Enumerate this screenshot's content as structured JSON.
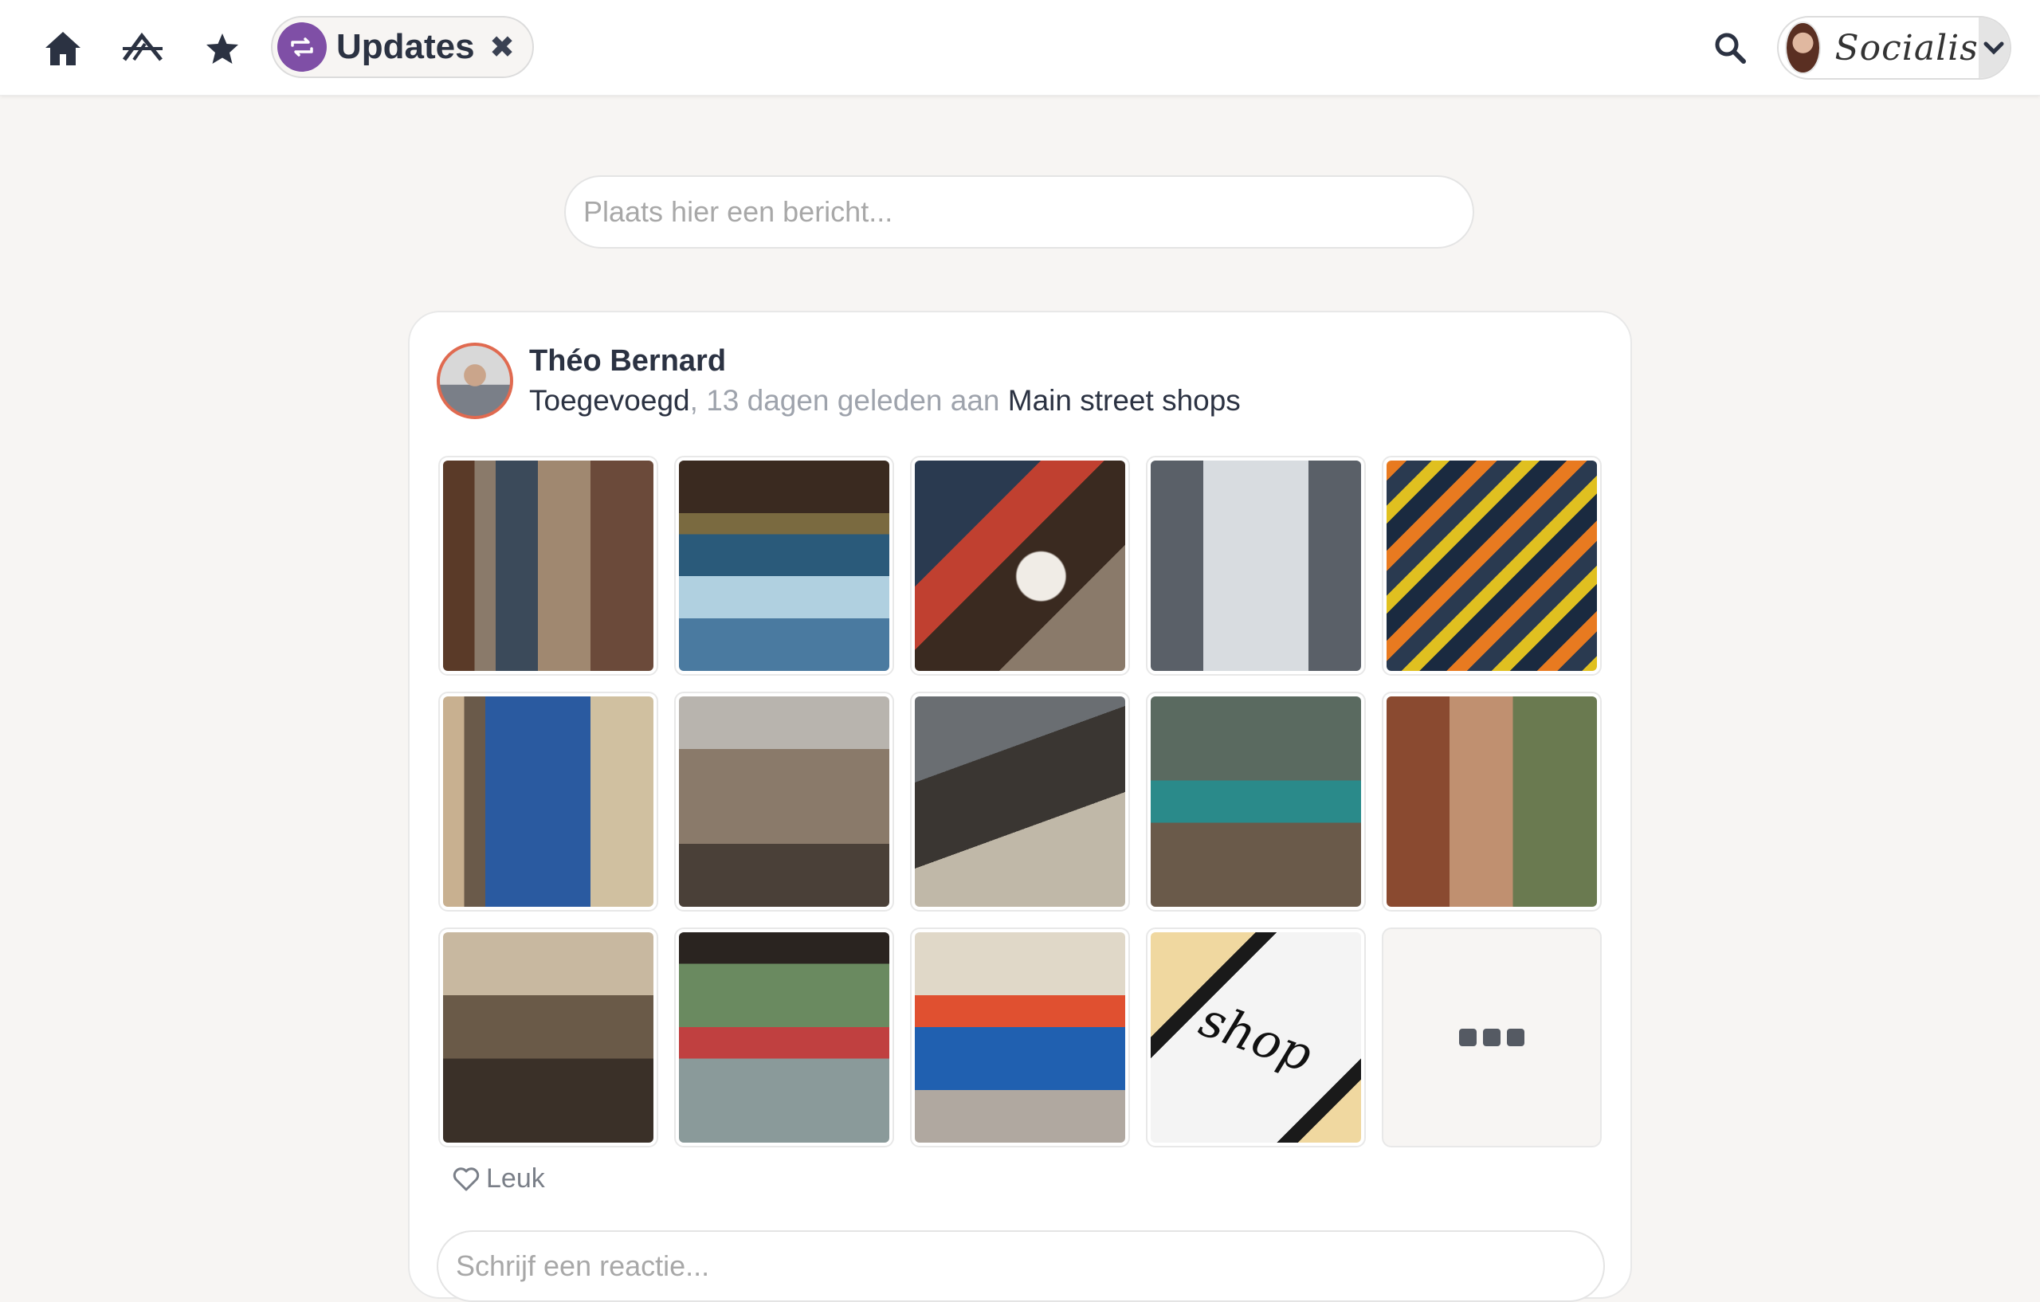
{
  "topbar": {
    "updates_label": "Updates",
    "close_glyph": "✖",
    "brand": "Socialis",
    "icons": [
      "home-icon",
      "crop-icon",
      "star-icon",
      "repeat-icon",
      "search-icon",
      "chevron-down-icon"
    ]
  },
  "composer": {
    "placeholder": "Plaats hier een bericht..."
  },
  "post": {
    "author": "Théo Bernard",
    "action": "Toegevoegd",
    "separator": ",",
    "time": "13 dagen geleden aan",
    "target": "Main street shops",
    "like_label": "Leuk",
    "comment_placeholder": "Schrijf een reactie...",
    "photo_14_text": "shop"
  },
  "colors": {
    "accent_purple": "#7f4fa6",
    "avatar_ring": "#e06a50",
    "text_dark": "#2b3242",
    "text_muted": "#9ea3ac",
    "page_bg": "#f7f5f3"
  }
}
